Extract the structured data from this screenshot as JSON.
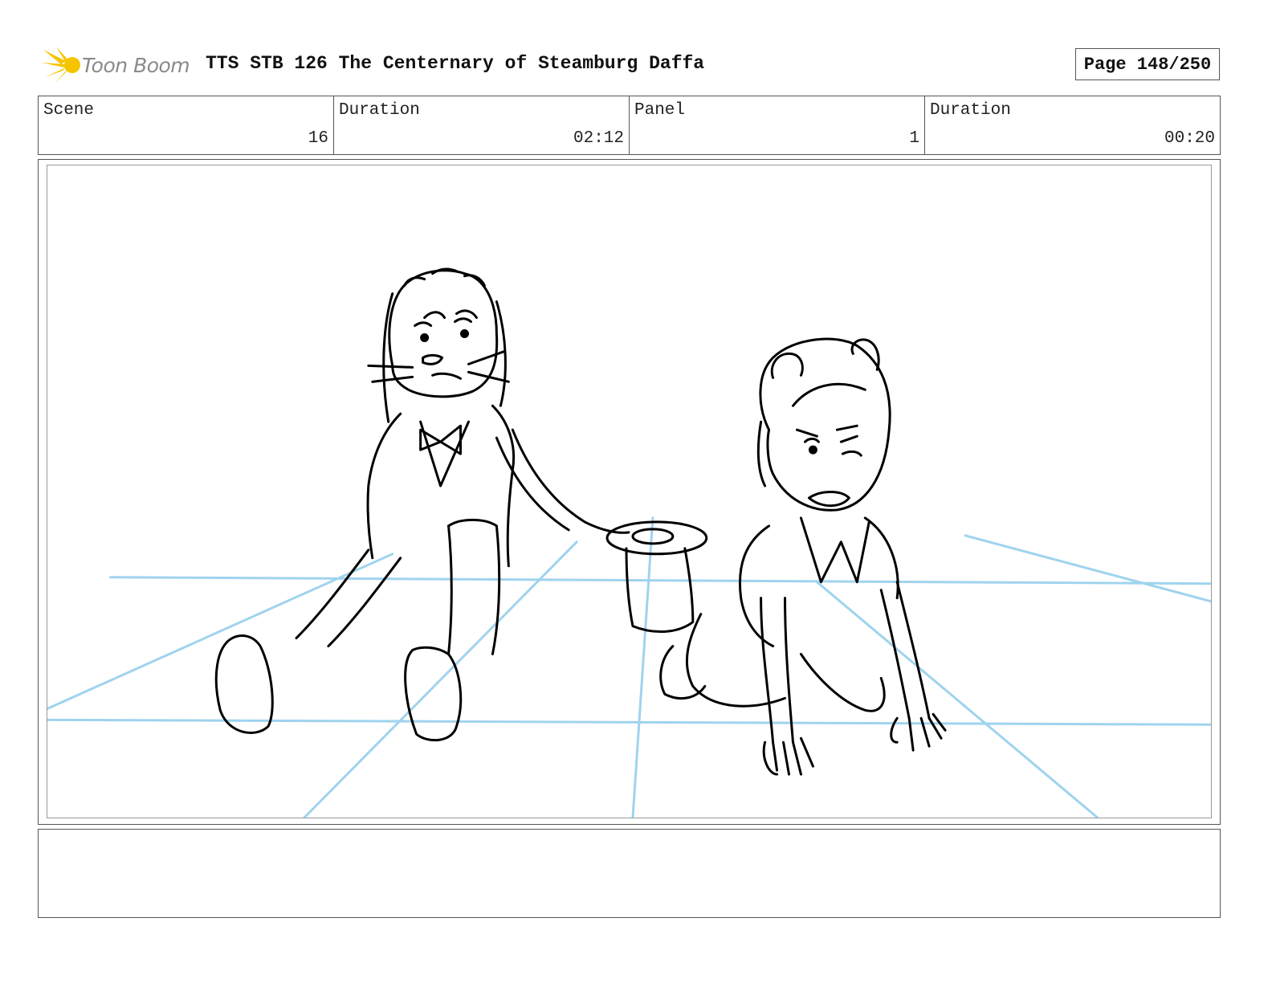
{
  "header": {
    "logo_text": "Toon Boom",
    "title": "TTS STB 126 The Centernary of Steamburg Daffa",
    "page_label": "Page 148/250"
  },
  "info": {
    "scene_label": "Scene",
    "scene_value": "16",
    "scene_duration_label": "Duration",
    "scene_duration_value": "02:12",
    "panel_label": "Panel",
    "panel_value": "1",
    "panel_duration_label": "Duration",
    "panel_duration_value": "00:20"
  },
  "panel": {
    "line_color": "#000000",
    "guide_color": "#9fd3ee"
  },
  "notes": {
    "text": ""
  },
  "colors": {
    "logo_accent": "#f5c400",
    "logo_text": "#8a8a8a",
    "border": "#555555"
  }
}
